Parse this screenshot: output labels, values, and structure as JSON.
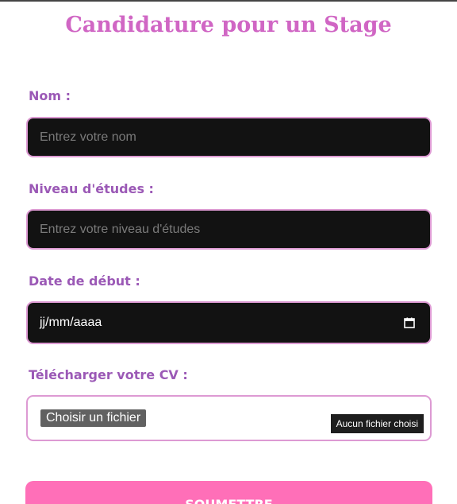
{
  "form": {
    "title": "Candidature pour un Stage",
    "name": {
      "label": "Nom :",
      "placeholder": "Entrez votre nom"
    },
    "education": {
      "label": "Niveau d'études :",
      "placeholder": "Entrez votre niveau d'études"
    },
    "start_date": {
      "label": "Date de début :",
      "value": "jj/mm/aaaa",
      "icon": "calendar-icon"
    },
    "cv": {
      "label": "Télécharger votre CV :",
      "button_label": "Choisir un fichier",
      "status": "Aucun fichier choisi"
    },
    "submit_label": "SOUMETTRE"
  },
  "colors": {
    "title": "#d066c4",
    "label": "#9b59b6",
    "field_bg": "#121212",
    "field_border": "#dd9ad3",
    "submit_bg": "#ff6fb8"
  }
}
